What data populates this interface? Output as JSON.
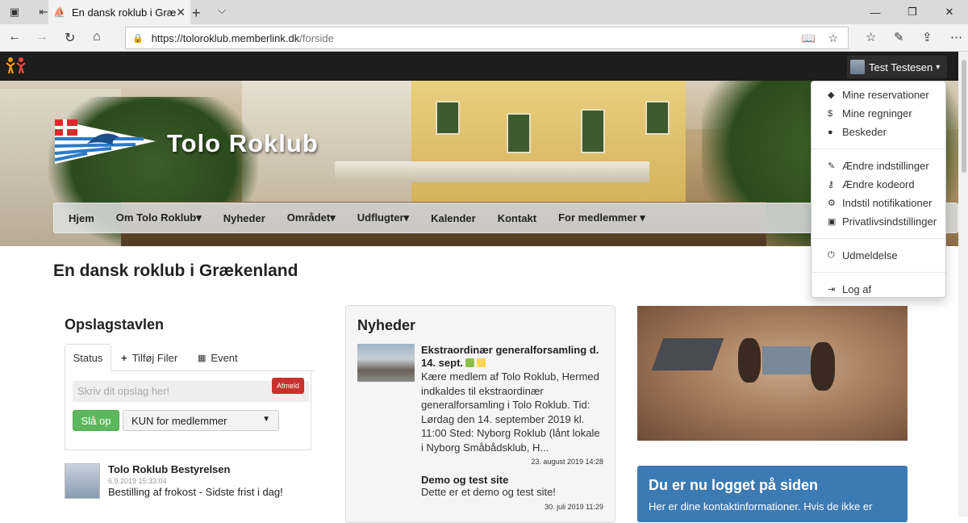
{
  "browser": {
    "tab_title": "En dansk roklub i Græke",
    "url_host": "https://toloroklub.memberlink.dk",
    "url_path": "/forside"
  },
  "topnav": {
    "user_name": "Test Testesen",
    "caret": "▾"
  },
  "hero": {
    "brand": "Tolo Roklub"
  },
  "mainnav": [
    {
      "label": "Hjem"
    },
    {
      "label": "Om Tolo Roklub▾"
    },
    {
      "label": "Nyheder"
    },
    {
      "label": "Området▾"
    },
    {
      "label": "Udflugter▾"
    },
    {
      "label": "Kalender"
    },
    {
      "label": "Kontakt"
    },
    {
      "label": "For medlemmer ▾"
    }
  ],
  "page_title": "En dansk roklub i Grækenland",
  "board": {
    "title": "Opslagstavlen",
    "tabs": {
      "status": "Status",
      "files": "Tilføj Filer",
      "event": "Event"
    },
    "afmeld": "Afmeld",
    "placeholder": "Skriv dit opslag her!",
    "submit": "Slå op",
    "audience": "KUN for medlemmer",
    "post": {
      "author": "Tolo Roklub Bestyrelsen",
      "date": "6.9.2019 15:33:04",
      "text": "Bestilling af frokost - Sidste frist i dag!"
    }
  },
  "news": {
    "title": "Nyheder",
    "items": [
      {
        "title": "Ekstraordinær generalforsamling d. 14. sept.",
        "body": "Kære medlem af Tolo Roklub, Hermed indkaldes til ekstraordinær generalforsamling i Tolo Roklub. Tid: Lørdag den 14. september 2019 kl. 11:00 Sted: Nyborg Roklub (lånt lokale i Nyborg Småbådsklub, H...",
        "date": "23. august 2019 14:28",
        "tag_colors": [
          "#8bc34a",
          "#ffd54f"
        ]
      },
      {
        "title": "Demo og test site",
        "body": "Dette er et demo og test site!",
        "date": "30. juli 2019 11:29"
      }
    ]
  },
  "info": {
    "title": "Du er nu logget på siden",
    "body": "Her er dine kontaktinformationer. Hvis de ikke er"
  },
  "user_menu": {
    "group1": [
      {
        "label": "Mine reservationer",
        "icon": "tag-icon"
      },
      {
        "label": "Mine regninger",
        "icon": "dollar-icon"
      },
      {
        "label": "Beskeder",
        "icon": "comments-icon"
      }
    ],
    "group2": [
      {
        "label": "Ændre indstillinger",
        "icon": "edit-icon"
      },
      {
        "label": "Ændre kodeord",
        "icon": "key-icon"
      },
      {
        "label": "Indstil notifikationer",
        "icon": "cogs-icon"
      },
      {
        "label": "Privatlivsindstillinger",
        "icon": "lock-icon"
      }
    ],
    "unsubscribe": {
      "label": "Udmeldelse",
      "icon": "power-icon"
    },
    "logout": {
      "label": "Log af",
      "icon": "sign-out-icon"
    }
  }
}
